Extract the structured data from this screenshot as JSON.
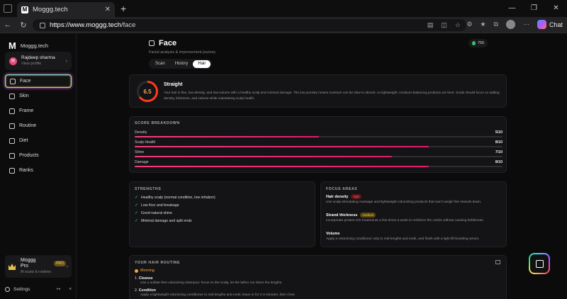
{
  "browser": {
    "tab_title": "Moggg.tech",
    "tab_favicon": "M",
    "url_host": "https://www.moggg.tech",
    "url_path": "/face",
    "chat_label": "Chat"
  },
  "sidebar": {
    "logo_mark": "M",
    "logo_text": "Moggg.tech",
    "profile": {
      "initial": "R",
      "name": "Rajdeep sharma",
      "sub": "View profile"
    },
    "items": [
      {
        "label": "Face",
        "icon": "face-icon"
      },
      {
        "label": "Skin",
        "icon": "skin-icon"
      },
      {
        "label": "Frame",
        "icon": "frame-icon"
      },
      {
        "label": "Routine",
        "icon": "routine-icon"
      },
      {
        "label": "Diet",
        "icon": "diet-icon"
      },
      {
        "label": "Products",
        "icon": "products-icon"
      },
      {
        "label": "Ranks",
        "icon": "ranks-icon"
      }
    ],
    "pro": {
      "title": "Moggg",
      "title2": "Pro",
      "badge": "PRO",
      "sub": "AI scans & routines"
    },
    "settings_label": "Settings",
    "logout_glyph": "↦",
    "collapse_glyph": "«"
  },
  "main": {
    "title": "Face",
    "subtitle": "Facial analysis & improvement journey",
    "tabs": [
      "Scan",
      "History",
      "Hair"
    ],
    "active_tab": "Hair",
    "tokens": "755",
    "summary": {
      "score": "6.5",
      "score_fraction": 0.65,
      "heading": "Straight",
      "description": "Your hair is fine, low-density, and low-volume with a healthy scalp and minimal damage. The low porosity means moisture can be slow to absorb, so lightweight, moisture-balancing products are best. Goals should focus on adding density, thickness, and volume while maintaining scalp health."
    },
    "breakdown_title": "SCORE BREAKDOWN",
    "breakdown": [
      {
        "label": "Density",
        "score": "5/10",
        "value": 5
      },
      {
        "label": "Scalp Health",
        "score": "8/10",
        "value": 8
      },
      {
        "label": "Shine",
        "score": "7/10",
        "value": 7
      },
      {
        "label": "Damage",
        "score": "8/10",
        "value": 8
      }
    ],
    "strengths_title": "STRENGTHS",
    "strengths": [
      "Healthy scalp (normal condition, low irritation)",
      "Low frizz and breakage",
      "Good natural shine",
      "Minimal damage and split ends"
    ],
    "focus_title": "FOCUS AREAS",
    "focus": [
      {
        "title": "Hair density",
        "tag": "high",
        "desc": "Use scalp-stimulating massage and lightweight volumizing products that won't weigh fine strands down."
      },
      {
        "title": "Strand thickness",
        "tag": "medium",
        "desc": "Incorporate protein-rich treatments a few times a week to reinforce the cuticle without causing brittleness."
      },
      {
        "title": "Volume",
        "tag": "medium",
        "desc": "Apply a volumizing conditioner only to mid-lengths and ends, and finish with a light lift-boosting serum."
      }
    ],
    "routine_title": "YOUR HAIR ROUTINE",
    "routine_period": "Morning",
    "routine_steps": [
      {
        "num": "1.",
        "title": "Cleanse",
        "desc": "Use a sulfate-free volumizing shampoo; focus on the scalp, let the lather run down the lengths."
      },
      {
        "num": "2.",
        "title": "Condition",
        "desc": "Apply a lightweight volumizing conditioner to mid-lengths and ends; leave in for 2-3 minutes, then rinse."
      }
    ]
  }
}
